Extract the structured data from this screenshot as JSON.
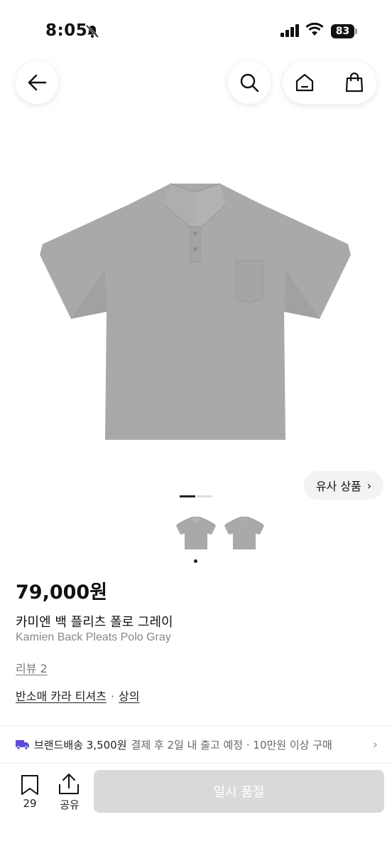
{
  "status_bar": {
    "time": "8:05",
    "battery": "83"
  },
  "nav": {
    "back_icon": "arrow-left-icon",
    "search_icon": "search-icon",
    "home_icon": "home-icon",
    "bag_icon": "shopping-bag-icon"
  },
  "gallery": {
    "similar_label": "유사 상품",
    "page_current": 1,
    "page_total": 2
  },
  "product": {
    "price": "79,000원",
    "name_ko": "카미엔 백 플리츠 폴로 그레이",
    "name_en": "Kamien Back Pleats Polo Gray",
    "review_link": "리뷰 2",
    "category_1": "반소매 카라 티셔츠",
    "category_sep": "·",
    "category_2": "상의"
  },
  "shipping": {
    "brand": "브랜드배송 3,500원",
    "detail": "결제 후 2일 내 출고 예정 · 10만원 이상 구매"
  },
  "bottom_bar": {
    "bookmark_count": "29",
    "share_label": "공유",
    "soldout_label": "일시 품절"
  },
  "colors": {
    "shirt": "#a8a8a8",
    "soldout_bg": "#d9d9d9",
    "shipping_icon": "#5b4bdb"
  }
}
